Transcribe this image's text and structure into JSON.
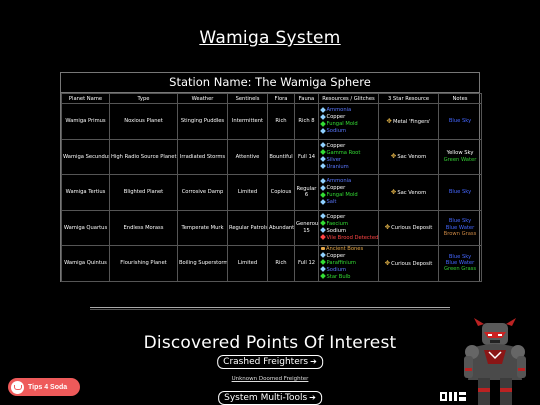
{
  "page": {
    "title": "Wamiga System"
  },
  "station": {
    "title": "Station Name: The Wamiga Sphere",
    "columns": [
      "Planet Name",
      "Type",
      "Weather",
      "Sentinels",
      "Flora",
      "Fauna",
      "Resources / Glitches",
      "3 Star Resource",
      "Notes"
    ],
    "planets": [
      {
        "name": "Wamiga Primus",
        "type": "Noxious Planet",
        "weather": "Stinging Puddles",
        "sentinels": "Intermittent",
        "flora": "Rich",
        "fauna": "Rich 8",
        "resources": [
          {
            "label": "Ammonia",
            "color": "#5a78ff",
            "icon": "diamond-blue"
          },
          {
            "label": "Copper",
            "color": "#ffffff",
            "icon": "diamond-blue"
          },
          {
            "label": "Fungal Mold",
            "color": "#33dd33",
            "icon": "diamond-green"
          },
          {
            "label": "Sodium",
            "color": "#5a78ff",
            "icon": "diamond-blue"
          }
        ],
        "star": "Metal 'Fingers'",
        "notes": [
          {
            "text": "Blue Sky",
            "color": "#4466ff"
          }
        ]
      },
      {
        "name": "Wamiga Secundus",
        "type": "High Radio Source Planet",
        "weather": "Irradiated Storms",
        "sentinels": "Attentive",
        "flora": "Bountiful",
        "fauna": "Full 14",
        "resources": [
          {
            "label": "Copper",
            "color": "#ffffff",
            "icon": "diamond-blue"
          },
          {
            "label": "Gamma Root",
            "color": "#33dd33",
            "icon": "diamond-green"
          },
          {
            "label": "Silver",
            "color": "#5a78ff",
            "icon": "diamond-blue"
          },
          {
            "label": "Uranium",
            "color": "#5a78ff",
            "icon": "diamond-blue"
          }
        ],
        "star": "Sac Venom",
        "notes": [
          {
            "text": "Yellow Sky",
            "color": "#ffffff"
          },
          {
            "text": "Green Water",
            "color": "#33cc33"
          }
        ]
      },
      {
        "name": "Wamiga Tertius",
        "type": "Blighted Planet",
        "weather": "Corrosive Damp",
        "sentinels": "Limited",
        "flora": "Copious",
        "fauna": "Regular 6",
        "resources": [
          {
            "label": "Ammonia",
            "color": "#5a78ff",
            "icon": "diamond-blue"
          },
          {
            "label": "Copper",
            "color": "#ffffff",
            "icon": "diamond-blue"
          },
          {
            "label": "Fungal Mold",
            "color": "#33dd33",
            "icon": "diamond-green"
          },
          {
            "label": "Salt",
            "color": "#5a78ff",
            "icon": "diamond-blue"
          }
        ],
        "star": "Sac Venom",
        "notes": [
          {
            "text": "Blue Sky",
            "color": "#4466ff"
          }
        ]
      },
      {
        "name": "Wamiga Quartus",
        "type": "Endless Morass",
        "weather": "Temperate Murk",
        "sentinels": "Regular Patrols",
        "flora": "Abundant",
        "fauna": "Generous 15",
        "resources": [
          {
            "label": "Copper",
            "color": "#ffffff",
            "icon": "diamond-blue"
          },
          {
            "label": "Faecium",
            "color": "#33dd33",
            "icon": "diamond-green"
          },
          {
            "label": "Sodium",
            "color": "#ffffff",
            "icon": "diamond-blue"
          },
          {
            "label": "Vile Brood Detected",
            "color": "#ff4444",
            "icon": "diamond-red"
          }
        ],
        "star": "Curious Deposit",
        "notes": [
          {
            "text": "Blue Sky",
            "color": "#4466ff"
          },
          {
            "text": "Blue Water",
            "color": "#4466ff"
          },
          {
            "text": "Brown Grass",
            "color": "#cc8844"
          }
        ]
      },
      {
        "name": "Wamiga Quintus",
        "type": "Flourishing Planet",
        "weather": "Boiling Superstorms",
        "sentinels": "Limited",
        "flora": "Rich",
        "fauna": "Full 12",
        "resources": [
          {
            "label": "Ancient Bones",
            "color": "#e8a94a",
            "icon": "square-gold"
          },
          {
            "label": "Copper",
            "color": "#ffffff",
            "icon": "diamond-blue"
          },
          {
            "label": "Paraffinium",
            "color": "#33dd33",
            "icon": "diamond-green"
          },
          {
            "label": "Sodium",
            "color": "#5a78ff",
            "icon": "diamond-blue"
          },
          {
            "label": "Star Bulb",
            "color": "#33dd33",
            "icon": "diamond-green"
          }
        ],
        "star": "Curious Deposit",
        "notes": [
          {
            "text": "Blue Sky",
            "color": "#4466ff"
          },
          {
            "text": "Blue Water",
            "color": "#4466ff"
          },
          {
            "text": "Green Grass",
            "color": "#33cc33"
          }
        ]
      }
    ]
  },
  "poi": {
    "title": "Discovered Points Of Interest",
    "freighters_label": "Crashed Freighters",
    "freighter_link": "Unknown Doomed Freighter",
    "multitools_label": "System Multi-Tools"
  },
  "badge": {
    "label": "Tips 4 Soda"
  },
  "colors": {
    "background": "#000000",
    "badge": "#ee5a5a",
    "star_icon": "#e8b84a"
  }
}
